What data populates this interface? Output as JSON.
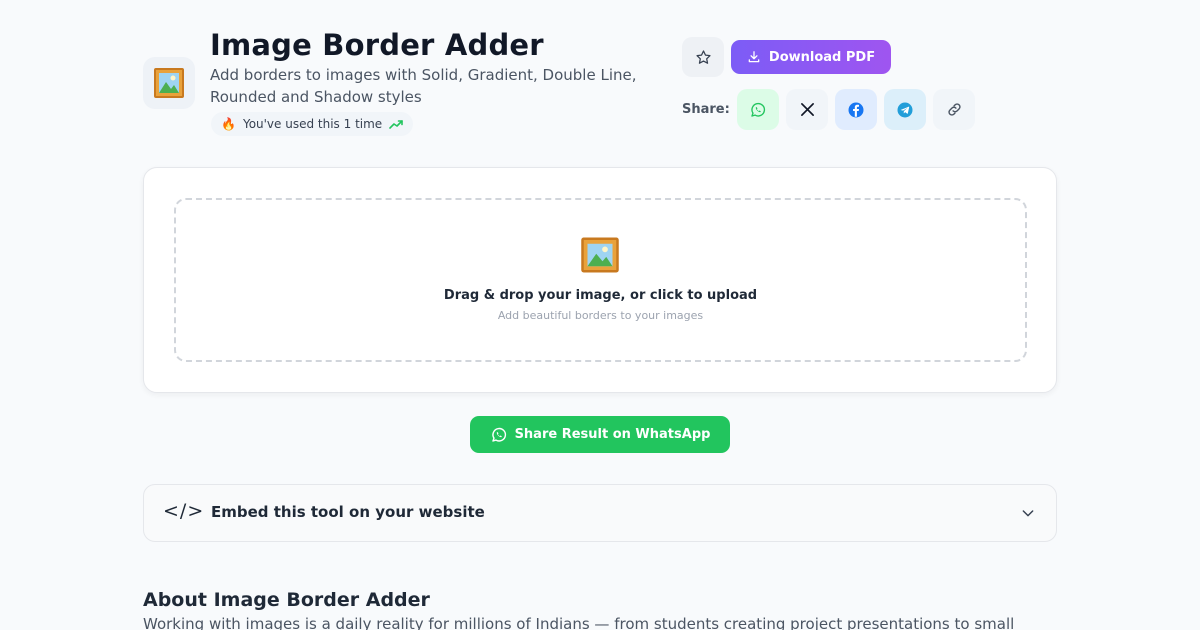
{
  "header": {
    "title": "Image Border Adder",
    "subtitle": "Add borders to images with Solid, Gradient, Double Line, Rounded and Shadow styles",
    "usage": "You've used this 1 time",
    "tool_icon": "framed-picture-icon"
  },
  "actions": {
    "favorite_icon": "star-icon",
    "download_label": "Download PDF",
    "share_label": "Share:",
    "share_targets": [
      "whatsapp",
      "x",
      "facebook",
      "telegram",
      "copy-link"
    ]
  },
  "upload": {
    "title": "Drag & drop your image, or click to upload",
    "hint": "Add beautiful borders to your images"
  },
  "whatsapp_share": {
    "label": "Share Result on WhatsApp"
  },
  "embed": {
    "icon": "</>",
    "title": "Embed this tool on your website"
  },
  "about": {
    "title": "About Image Border Adder",
    "text": "Working with images is a daily reality for millions of Indians — from students creating project presentations to small"
  },
  "colors": {
    "accent_start": "#7c5cf6",
    "accent_end": "#9f55f0",
    "whatsapp": "#22c55e",
    "facebook": "#1877f2",
    "telegram": "#229ed9"
  }
}
